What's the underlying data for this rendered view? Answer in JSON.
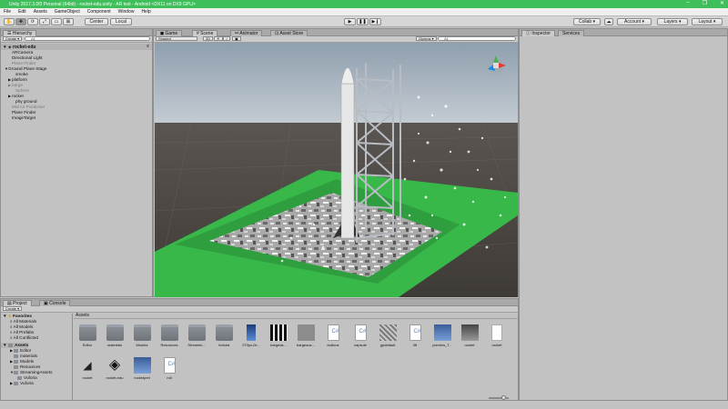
{
  "window": {
    "title": "Unity 2017.3.0f3 Personal (64bit) - rocket-edu.unity - AR test - Android <DX11 on DX9 GPU>",
    "controls": [
      "–",
      "❐",
      "✕"
    ]
  },
  "menu": [
    "File",
    "Edit",
    "Assets",
    "GameObject",
    "Component",
    "Window",
    "Help"
  ],
  "toolbar": {
    "pivot_label": "Center",
    "space_label": "Local",
    "collab_label": "Collab ▾",
    "account_label": "Account ▾",
    "layers_label": "Layers ▾",
    "layout_label": "Layout ▾"
  },
  "hierarchy": {
    "tab": "Hierarchy",
    "create_label": "Create ▾",
    "search_placeholder": "All",
    "scene_name": "rocket-edu",
    "items": [
      {
        "label": "ARCamera",
        "indent": 2,
        "arrow": "",
        "dim": false
      },
      {
        "label": "Directional Light",
        "indent": 2,
        "arrow": "",
        "dim": false
      },
      {
        "label": "Plane Finder",
        "indent": 2,
        "arrow": "",
        "dim": true
      },
      {
        "label": "Ground Plane Stage",
        "indent": 1,
        "arrow": "▼",
        "dim": false
      },
      {
        "label": "smoke",
        "indent": 3,
        "arrow": "",
        "dim": false
      },
      {
        "label": "platform",
        "indent": 2,
        "arrow": "▶",
        "dim": false
      },
      {
        "label": "barge",
        "indent": 2,
        "arrow": "▶",
        "dim": true
      },
      {
        "label": "Sphere",
        "indent": 3,
        "arrow": "",
        "dim": true
      },
      {
        "label": "rocket",
        "indent": 2,
        "arrow": "▶",
        "dim": false
      },
      {
        "label": "phy ground",
        "indent": 3,
        "arrow": "",
        "dim": false
      },
      {
        "label": "Mid Air Positioner",
        "indent": 2,
        "arrow": "",
        "dim": true
      },
      {
        "label": "Plane Finder",
        "indent": 2,
        "arrow": "",
        "dim": false
      },
      {
        "label": "ImageTarget",
        "indent": 2,
        "arrow": "",
        "dim": false
      }
    ]
  },
  "scene": {
    "tabs": [
      "Game",
      "Scene",
      "Animator",
      "Asset Store"
    ],
    "shading": "Shaded",
    "mode_2d": "2D",
    "gizmos": "Gizmos ▾",
    "search_placeholder": "All"
  },
  "inspector": {
    "tabs": [
      "Inspector",
      "Services"
    ]
  },
  "project": {
    "tabs": [
      "Project",
      "Console"
    ],
    "create_label": "Create ▾",
    "favorites_title": "Favorites",
    "favorites": [
      "All Materials",
      "All Models",
      "All Prefabs",
      "All Conflicted"
    ],
    "assets_title": "Assets",
    "folders": [
      {
        "label": "Editor",
        "indent": 1,
        "arrow": "▶"
      },
      {
        "label": "materials",
        "indent": 1,
        "arrow": ""
      },
      {
        "label": "Models",
        "indent": 1,
        "arrow": "▶"
      },
      {
        "label": "Resources",
        "indent": 1,
        "arrow": ""
      },
      {
        "label": "StreamingAssets",
        "indent": 1,
        "arrow": "▼"
      },
      {
        "label": "Vuforia",
        "indent": 2,
        "arrow": ""
      },
      {
        "label": "Vuforia",
        "indent": 1,
        "arrow": "▶"
      }
    ],
    "breadcrumb": "Assets",
    "assets_row1": [
      {
        "label": "Editor",
        "kind": "folder"
      },
      {
        "label": "materials",
        "kind": "folder"
      },
      {
        "label": "Models",
        "kind": "folder"
      },
      {
        "label": "Resources",
        "kind": "folder"
      },
      {
        "label": "Streamin...",
        "kind": "folder"
      },
      {
        "label": "Vuforia",
        "kind": "folder"
      },
      {
        "label": "270px-Dr...",
        "kind": "image-blue"
      },
      {
        "label": "bargeas...",
        "kind": "image-bw"
      },
      {
        "label": "bargeaux...",
        "kind": "image-gray"
      },
      {
        "label": "buttons",
        "kind": "script"
      },
      {
        "label": "capsule",
        "kind": "script"
      },
      {
        "label": "gpdefault",
        "kind": "image-noise"
      },
      {
        "label": "lift",
        "kind": "script"
      },
      {
        "label": "preview_T...",
        "kind": "image-rocket"
      },
      {
        "label": "rocket",
        "kind": "image-dark"
      },
      {
        "label": "rocket",
        "kind": "file"
      }
    ],
    "assets_row2": [
      {
        "label": "rocket",
        "kind": "unity"
      },
      {
        "label": "rocket-edu",
        "kind": "unity-big"
      },
      {
        "label": "rocketprel",
        "kind": "image-rocket"
      },
      {
        "label": "roll",
        "kind": "script"
      }
    ]
  },
  "colors": {
    "titlebar": "#3fbf5a",
    "sky": "#aab7c4",
    "ground": "#4a4640",
    "platform_green": "#3bbd45"
  }
}
